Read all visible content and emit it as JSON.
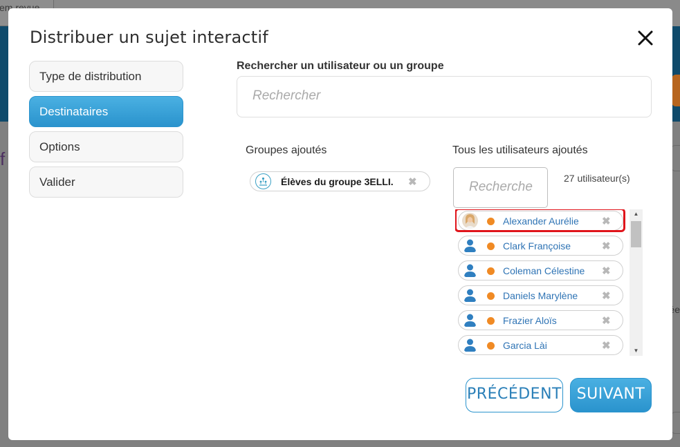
{
  "background": {
    "tab_text": "em revue"
  },
  "modal": {
    "title": "Distribuer un sujet interactif",
    "close_glyph": "✕",
    "steps": [
      {
        "label": "Type de distribution",
        "active": false
      },
      {
        "label": "Destinataires",
        "active": true
      },
      {
        "label": "Options",
        "active": false
      },
      {
        "label": "Valider",
        "active": false
      }
    ],
    "search": {
      "label": "Rechercher un utilisateur ou un groupe",
      "placeholder": "Rechercher"
    },
    "groups": {
      "label": "Groupes ajoutés",
      "items": [
        {
          "name": "Élèves du groupe 3ELLI.",
          "icon": "group-icon"
        }
      ]
    },
    "users": {
      "label": "Tous les utilisateurs ajoutés",
      "filter_placeholder": "Recherche",
      "count": "27 utilisateur(s)",
      "items": [
        {
          "name": "Alexander Aurélie",
          "avatar": "photo",
          "status_color": "#f08a24",
          "highlighted": true
        },
        {
          "name": "Clark Françoise",
          "avatar": "user-icon",
          "status_color": "#f08a24",
          "highlighted": false
        },
        {
          "name": "Coleman Célestine",
          "avatar": "user-icon",
          "status_color": "#f08a24",
          "highlighted": false
        },
        {
          "name": "Daniels Marylène",
          "avatar": "user-icon",
          "status_color": "#f08a24",
          "highlighted": false
        },
        {
          "name": "Frazier Aloïs",
          "avatar": "user-icon",
          "status_color": "#f08a24",
          "highlighted": false
        },
        {
          "name": "Garcia Lài",
          "avatar": "user-icon",
          "status_color": "#f08a24",
          "highlighted": false
        }
      ],
      "remove_glyph": "✖"
    },
    "buttons": {
      "previous": "PRÉCÉDENT",
      "next": "SUIVANT"
    }
  },
  "colors": {
    "accent": "#2a93cd",
    "status_orange": "#f08a24",
    "highlight_red": "#e0141b"
  }
}
